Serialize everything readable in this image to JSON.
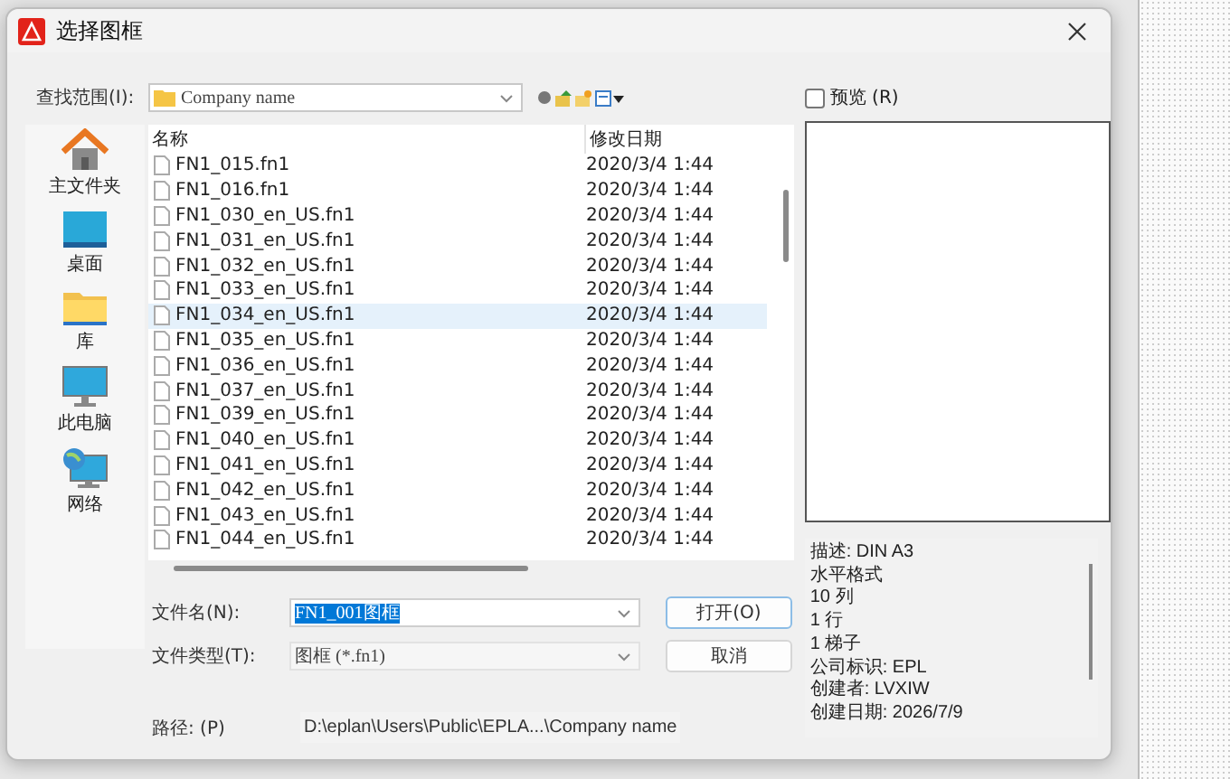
{
  "window": {
    "title": "选择图框"
  },
  "look_in": {
    "label": "查找范围(I):",
    "value": "Company name"
  },
  "preview": {
    "label": "预览 (R)",
    "checked": false
  },
  "places": [
    {
      "kind": "home",
      "label": "主文件夹"
    },
    {
      "kind": "desktop",
      "label": "桌面"
    },
    {
      "kind": "library",
      "label": "库"
    },
    {
      "kind": "computer",
      "label": "此电脑"
    },
    {
      "kind": "network",
      "label": "网络"
    }
  ],
  "files": {
    "columns": [
      "名称",
      "修改日期"
    ],
    "rows": [
      {
        "name": "FN1_015.fn1",
        "date": "2020/3/4 1:44",
        "selected": false
      },
      {
        "name": "FN1_016.fn1",
        "date": "2020/3/4 1:44",
        "selected": false
      },
      {
        "name": "FN1_030_en_US.fn1",
        "date": "2020/3/4 1:44",
        "selected": false
      },
      {
        "name": "FN1_031_en_US.fn1",
        "date": "2020/3/4 1:44",
        "selected": false
      },
      {
        "name": "FN1_032_en_US.fn1",
        "date": "2020/3/4 1:44",
        "selected": false
      },
      {
        "name": "FN1_033_en_US.fn1",
        "date": "2020/3/4 1:44",
        "selected": false
      },
      {
        "name": "FN1_034_en_US.fn1",
        "date": "2020/3/4 1:44",
        "selected": true
      },
      {
        "name": "FN1_035_en_US.fn1",
        "date": "2020/3/4 1:44",
        "selected": false
      },
      {
        "name": "FN1_036_en_US.fn1",
        "date": "2020/3/4 1:44",
        "selected": false
      },
      {
        "name": "FN1_037_en_US.fn1",
        "date": "2020/3/4 1:44",
        "selected": false
      },
      {
        "name": "FN1_039_en_US.fn1",
        "date": "2020/3/4 1:44",
        "selected": false
      },
      {
        "name": "FN1_040_en_US.fn1",
        "date": "2020/3/4 1:44",
        "selected": false
      },
      {
        "name": "FN1_041_en_US.fn1",
        "date": "2020/3/4 1:44",
        "selected": false
      },
      {
        "name": "FN1_042_en_US.fn1",
        "date": "2020/3/4 1:44",
        "selected": false
      },
      {
        "name": "FN1_043_en_US.fn1",
        "date": "2020/3/4 1:44",
        "selected": false
      },
      {
        "name": "FN1_044_en_US.fn1",
        "date": "2020/3/4 1:44",
        "selected": false
      }
    ]
  },
  "file_name": {
    "label": "文件名(N):",
    "value": "FN1_001图框"
  },
  "file_type": {
    "label": "文件类型(T):",
    "value": "图框 (*.fn1)"
  },
  "buttons": [
    "打开(O)",
    "取消"
  ],
  "path": {
    "label": "路径: (P)",
    "value": "D:\\eplan\\Users\\Public\\EPLA...\\Company name"
  },
  "info": [
    "描述: DIN A3",
    "水平格式",
    "10 列",
    "1 行",
    "1 梯子",
    "公司标识: EPL",
    "创建者: LVXIW",
    "创建日期: 2026/7/9"
  ]
}
